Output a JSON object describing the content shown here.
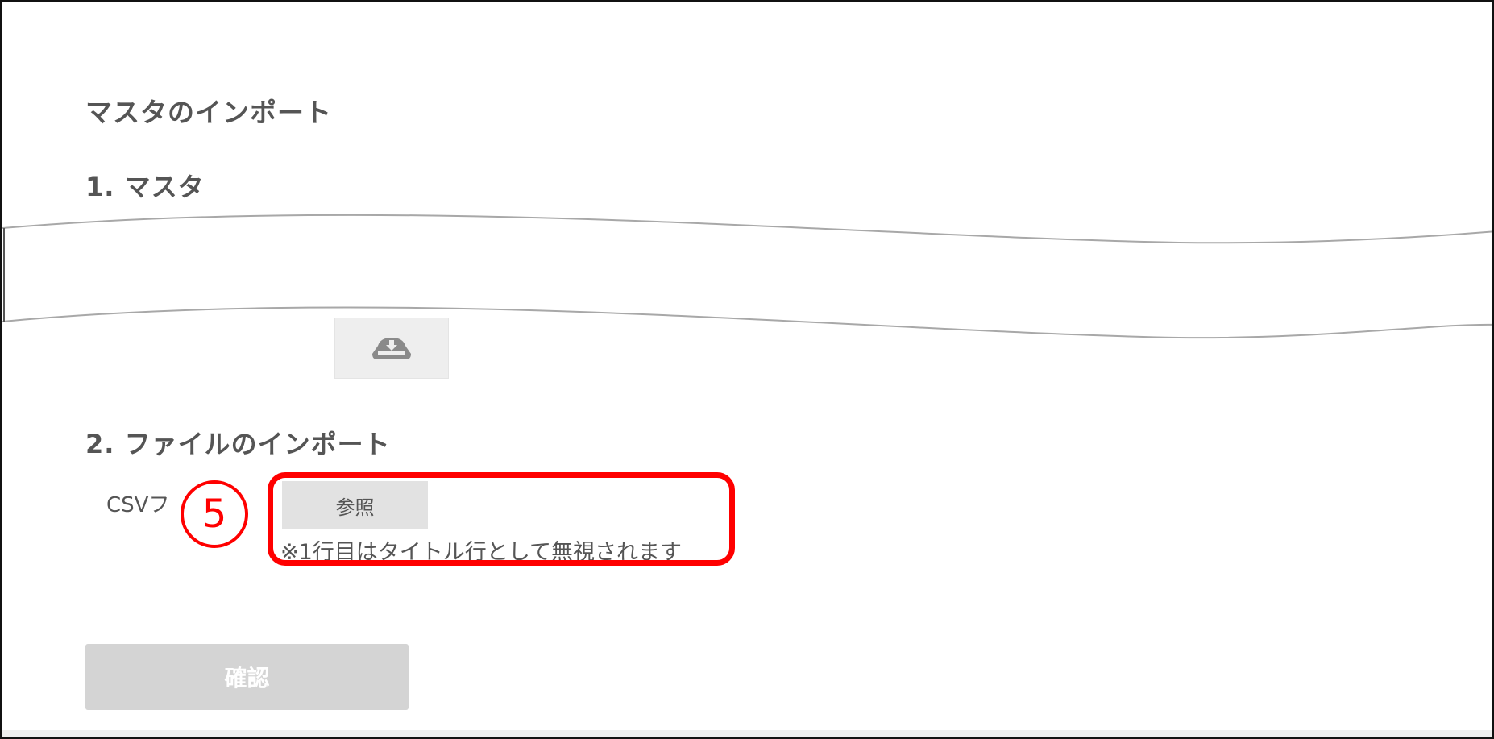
{
  "page": {
    "title": "マスタのインポート"
  },
  "section1": {
    "title": "1. マスタ",
    "download_icon": "cloud-download-icon"
  },
  "section2": {
    "title": "2. ファイルのインポート",
    "csv_label": "CSVフ",
    "browse_label": "参照",
    "note": "※1行目はタイトル行として無視されます"
  },
  "annotation": {
    "step_number": "⑤",
    "highlight_color": "#ff0000"
  },
  "actions": {
    "confirm_label": "確認"
  },
  "colors": {
    "text": "#555555",
    "button_bg": "#e2e2e2",
    "confirm_bg": "#d4d4d4",
    "accent_red": "#ff0000"
  }
}
